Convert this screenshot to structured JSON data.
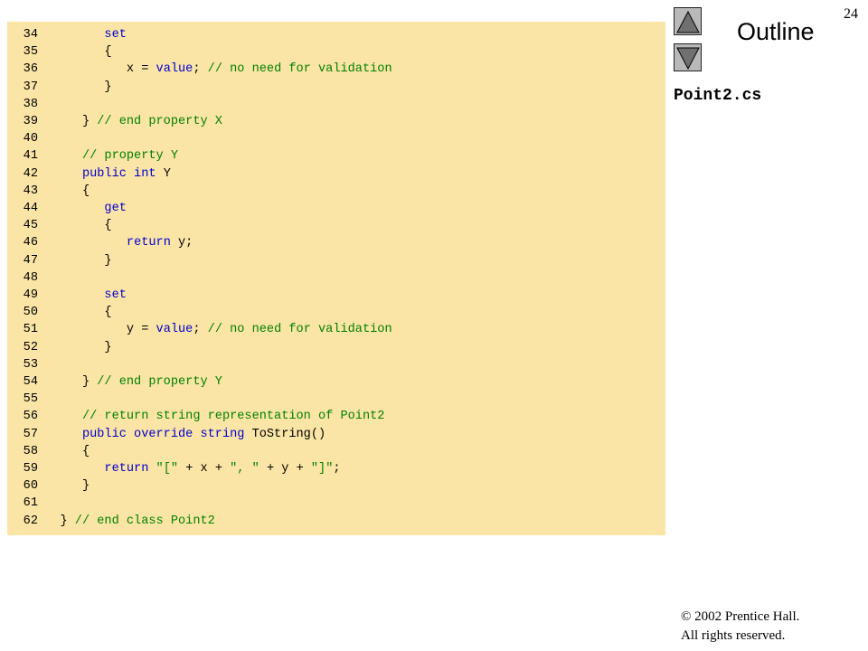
{
  "page_number": "24",
  "outline": {
    "title": "Outline",
    "filename": "Point2.cs"
  },
  "nav": {
    "up_icon": "triangle-up-icon",
    "down_icon": "triangle-down-icon"
  },
  "colors": {
    "code_background": "#fbe5a6",
    "keyword": "#0000cc",
    "comment": "#008000"
  },
  "code_lines": [
    [
      {
        "t": "34",
        "c": "ln"
      },
      {
        "t": "         ",
        "c": "pn"
      },
      {
        "t": "set",
        "c": "kw"
      }
    ],
    [
      {
        "t": "35",
        "c": "ln"
      },
      {
        "t": "         {",
        "c": "pn"
      }
    ],
    [
      {
        "t": "36",
        "c": "ln"
      },
      {
        "t": "            x = ",
        "c": "pn"
      },
      {
        "t": "value",
        "c": "kw"
      },
      {
        "t": "; ",
        "c": "pn"
      },
      {
        "t": "// no need for validation",
        "c": "cm"
      }
    ],
    [
      {
        "t": "37",
        "c": "ln"
      },
      {
        "t": "         }",
        "c": "pn"
      }
    ],
    [
      {
        "t": "38",
        "c": "ln"
      }
    ],
    [
      {
        "t": "39",
        "c": "ln"
      },
      {
        "t": "      } ",
        "c": "pn"
      },
      {
        "t": "// end property X",
        "c": "cm"
      }
    ],
    [
      {
        "t": "40",
        "c": "ln"
      }
    ],
    [
      {
        "t": "41",
        "c": "ln"
      },
      {
        "t": "      ",
        "c": "pn"
      },
      {
        "t": "// property Y",
        "c": "cm"
      }
    ],
    [
      {
        "t": "42",
        "c": "ln"
      },
      {
        "t": "      ",
        "c": "pn"
      },
      {
        "t": "public int",
        "c": "kw"
      },
      {
        "t": " Y",
        "c": "pn"
      }
    ],
    [
      {
        "t": "43",
        "c": "ln"
      },
      {
        "t": "      {",
        "c": "pn"
      }
    ],
    [
      {
        "t": "44",
        "c": "ln"
      },
      {
        "t": "         ",
        "c": "pn"
      },
      {
        "t": "get",
        "c": "kw"
      }
    ],
    [
      {
        "t": "45",
        "c": "ln"
      },
      {
        "t": "         {",
        "c": "pn"
      }
    ],
    [
      {
        "t": "46",
        "c": "ln"
      },
      {
        "t": "            ",
        "c": "pn"
      },
      {
        "t": "return",
        "c": "kw"
      },
      {
        "t": " y;",
        "c": "pn"
      }
    ],
    [
      {
        "t": "47",
        "c": "ln"
      },
      {
        "t": "         }",
        "c": "pn"
      }
    ],
    [
      {
        "t": "48",
        "c": "ln"
      }
    ],
    [
      {
        "t": "49",
        "c": "ln"
      },
      {
        "t": "         ",
        "c": "pn"
      },
      {
        "t": "set",
        "c": "kw"
      }
    ],
    [
      {
        "t": "50",
        "c": "ln"
      },
      {
        "t": "         {",
        "c": "pn"
      }
    ],
    [
      {
        "t": "51",
        "c": "ln"
      },
      {
        "t": "            y = ",
        "c": "pn"
      },
      {
        "t": "value",
        "c": "kw"
      },
      {
        "t": "; ",
        "c": "pn"
      },
      {
        "t": "// no need for validation",
        "c": "cm"
      }
    ],
    [
      {
        "t": "52",
        "c": "ln"
      },
      {
        "t": "         }",
        "c": "pn"
      }
    ],
    [
      {
        "t": "53",
        "c": "ln"
      }
    ],
    [
      {
        "t": "54",
        "c": "ln"
      },
      {
        "t": "      } ",
        "c": "pn"
      },
      {
        "t": "// end property Y",
        "c": "cm"
      }
    ],
    [
      {
        "t": "55",
        "c": "ln"
      }
    ],
    [
      {
        "t": "56",
        "c": "ln"
      },
      {
        "t": "      ",
        "c": "pn"
      },
      {
        "t": "// return string representation of Point2",
        "c": "cm"
      }
    ],
    [
      {
        "t": "57",
        "c": "ln"
      },
      {
        "t": "      ",
        "c": "pn"
      },
      {
        "t": "public override string",
        "c": "kw"
      },
      {
        "t": " ToString()",
        "c": "pn"
      }
    ],
    [
      {
        "t": "58",
        "c": "ln"
      },
      {
        "t": "      {",
        "c": "pn"
      }
    ],
    [
      {
        "t": "59",
        "c": "ln"
      },
      {
        "t": "         ",
        "c": "pn"
      },
      {
        "t": "return",
        "c": "kw"
      },
      {
        "t": " ",
        "c": "pn"
      },
      {
        "t": "\"[\"",
        "c": "st"
      },
      {
        "t": " + x + ",
        "c": "pn"
      },
      {
        "t": "\", \"",
        "c": "st"
      },
      {
        "t": " + y + ",
        "c": "pn"
      },
      {
        "t": "\"]\"",
        "c": "st"
      },
      {
        "t": ";",
        "c": "pn"
      }
    ],
    [
      {
        "t": "60",
        "c": "ln"
      },
      {
        "t": "      }",
        "c": "pn"
      }
    ],
    [
      {
        "t": "61",
        "c": "ln"
      }
    ],
    [
      {
        "t": "62",
        "c": "ln"
      },
      {
        "t": "   } ",
        "c": "pn"
      },
      {
        "t": "// end class Point2",
        "c": "cm"
      }
    ]
  ],
  "copyright": {
    "line1": "© 2002 Prentice Hall.",
    "line2": "All rights reserved."
  }
}
